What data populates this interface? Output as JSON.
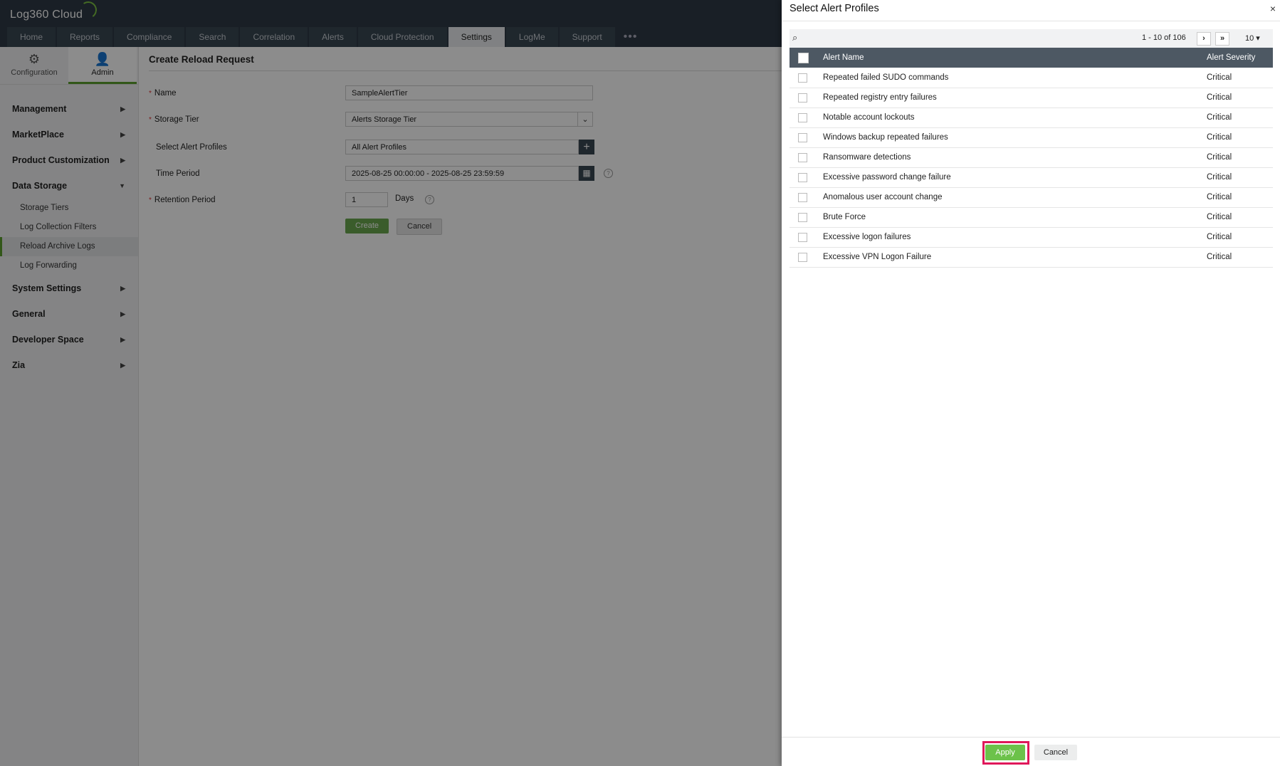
{
  "app": {
    "logo": "Log360 Cloud",
    "tabs": [
      "Home",
      "Reports",
      "Compliance",
      "Search",
      "Correlation",
      "Alerts",
      "Cloud Protection",
      "Settings",
      "LogMe",
      "Support"
    ],
    "more_tabs": "•••",
    "active_tab": "Settings"
  },
  "sidebar": {
    "tabs": [
      {
        "label": "Configuration",
        "icon": "gear-icon"
      },
      {
        "label": "Admin",
        "icon": "user-icon"
      }
    ],
    "menu": [
      {
        "label": "Management"
      },
      {
        "label": "MarketPlace"
      },
      {
        "label": "Product Customization"
      },
      {
        "label": "Data Storage",
        "expanded": true
      },
      {
        "label": "System Settings"
      },
      {
        "label": "General"
      },
      {
        "label": "Developer Space"
      },
      {
        "label": "Zia"
      }
    ],
    "data_storage_items": [
      "Storage Tiers",
      "Log Collection Filters",
      "Reload Archive Logs",
      "Log Forwarding"
    ],
    "active_item": "Reload Archive Logs"
  },
  "form": {
    "title": "Create Reload Request",
    "name_label": "Name",
    "name_value": "SampleAlertTier",
    "tier_label": "Storage Tier",
    "tier_value": "Alerts Storage Tier",
    "profiles_label": "Select Alert Profiles",
    "profiles_value": "All Alert Profiles",
    "time_label": "Time Period",
    "time_value": "2025-08-25 00:00:00 - 2025-08-25 23:59:59",
    "retention_label": "Retention Period",
    "retention_value": "1",
    "retention_unit": "Days",
    "create_label": "Create",
    "cancel_label": "Cancel"
  },
  "drawer": {
    "title": "Select Alert Profiles",
    "close": "×",
    "pagination": {
      "text": "1 - 10 of 106",
      "next": "›",
      "last": "»",
      "page_size": "10 ▾"
    },
    "columns": {
      "name": "Alert Name",
      "severity": "Alert Severity"
    },
    "rows": [
      {
        "name": "Repeated failed SUDO commands",
        "severity": "Critical"
      },
      {
        "name": "Repeated registry entry failures",
        "severity": "Critical"
      },
      {
        "name": "Notable account lockouts",
        "severity": "Critical"
      },
      {
        "name": "Windows backup repeated failures",
        "severity": "Critical"
      },
      {
        "name": "Ransomware detections",
        "severity": "Critical"
      },
      {
        "name": "Excessive password change failure",
        "severity": "Critical"
      },
      {
        "name": "Anomalous user account change",
        "severity": "Critical"
      },
      {
        "name": "Brute Force",
        "severity": "Critical"
      },
      {
        "name": "Excessive logon failures",
        "severity": "Critical"
      },
      {
        "name": "Excessive VPN Logon Failure",
        "severity": "Critical"
      }
    ],
    "apply_label": "Apply",
    "cancel_label": "Cancel"
  },
  "colors": {
    "accent": "#6cc24a",
    "highlight": "#e0185a",
    "header": "#2e3a46",
    "table_header": "#4d5863"
  }
}
